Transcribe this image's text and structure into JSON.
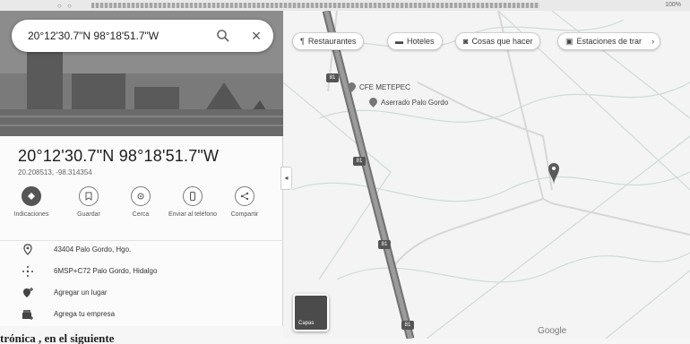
{
  "browser": {
    "right_text": "100%"
  },
  "search": {
    "value": "20°12'30.7\"N 98°18'51.7\"W"
  },
  "place": {
    "title": "20°12'30.7\"N 98°18'51.7\"W",
    "coords": "20.208513, -98.314354"
  },
  "actions": [
    {
      "label": "Indicaciones",
      "icon": "directions-icon"
    },
    {
      "label": "Guardar",
      "icon": "bookmark-icon"
    },
    {
      "label": "Cerca",
      "icon": "nearby-icon"
    },
    {
      "label": "Enviar al teléfono",
      "icon": "phone-icon"
    },
    {
      "label": "Compartir",
      "icon": "share-icon"
    }
  ],
  "info": [
    {
      "text": "43404 Palo Gordo, Hgo.",
      "icon": "location-pin-icon"
    },
    {
      "text": "6MSP+C72 Palo Gordo, Hidalgo",
      "icon": "plus-code-icon"
    },
    {
      "text": "Agregar un lugar",
      "icon": "add-place-icon"
    },
    {
      "text": "Agrega tu empresa",
      "icon": "business-icon"
    }
  ],
  "chips": [
    {
      "label": "Restaurantes",
      "glyph": "¶"
    },
    {
      "label": "Hoteles",
      "glyph": "▬"
    },
    {
      "label": "Cosas que hacer",
      "glyph": "◙"
    },
    {
      "label": "Estaciones de trar",
      "glyph": "▣"
    }
  ],
  "map": {
    "pois": [
      "CFE METEPEC",
      "Aserrado Palo Gordo"
    ],
    "road_labels": [
      "81",
      "81",
      "81",
      "81"
    ],
    "layers_label": "Capas",
    "attribution": "Google"
  },
  "bottom_text": "trónica , en el siguiente"
}
